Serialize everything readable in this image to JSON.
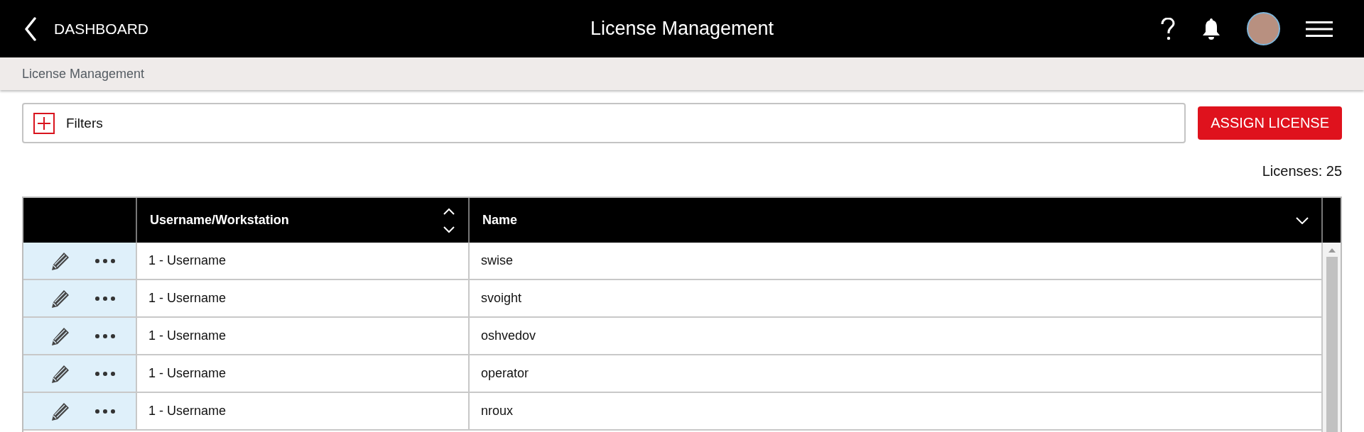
{
  "header": {
    "back_label": "DASHBOARD",
    "title": "License Management"
  },
  "breadcrumb": "License Management",
  "filters": {
    "label": "Filters",
    "expanded": false
  },
  "assign_button": "ASSIGN LICENSE",
  "license_count": "Licenses: 25",
  "table": {
    "columns": [
      {
        "label": "Username/Workstation",
        "sorted": false
      },
      {
        "label": "Name",
        "sorted": true
      }
    ],
    "rows": [
      {
        "username": "1 - Username",
        "name": "swise"
      },
      {
        "username": "1 - Username",
        "name": "svoight"
      },
      {
        "username": "1 - Username",
        "name": "oshvedov"
      },
      {
        "username": "1 - Username",
        "name": "operator"
      },
      {
        "username": "1 - Username",
        "name": "nroux"
      }
    ]
  }
}
